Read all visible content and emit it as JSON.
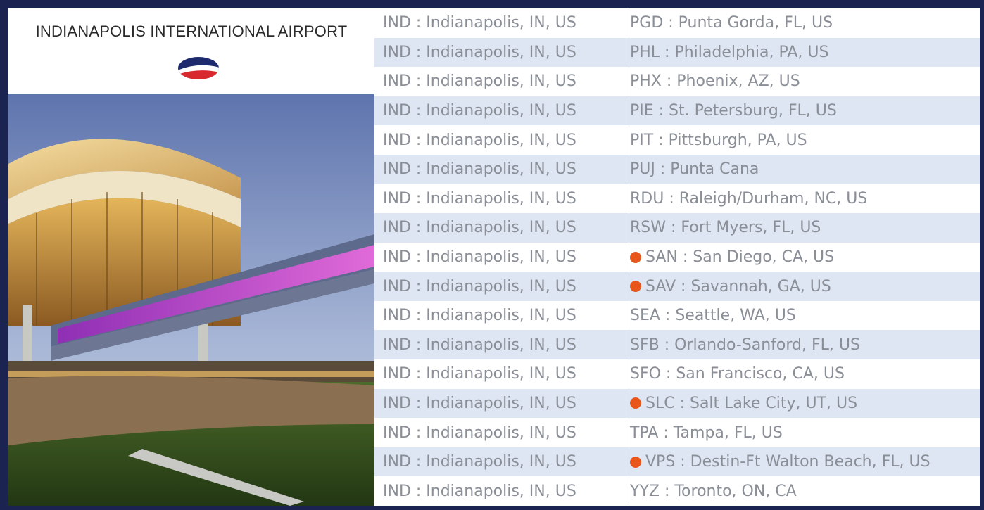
{
  "brand": {
    "title": "INDIANAPOLIS INTERNATIONAL AIRPORT",
    "logo_icon": "airline-logo-icon"
  },
  "colors": {
    "frame": "#1b2350",
    "row_alt": "#dfe6f3",
    "text": "#8a8e96",
    "highlight_dot": "#e8561b"
  },
  "routes": [
    {
      "origin": "IND : Indianapolis, IN, US",
      "dest": "PGD : Punta Gorda, FL, US",
      "highlight": false
    },
    {
      "origin": "IND : Indianapolis, IN, US",
      "dest": "PHL : Philadelphia, PA, US",
      "highlight": false
    },
    {
      "origin": "IND : Indianapolis, IN, US",
      "dest": "PHX : Phoenix, AZ, US",
      "highlight": false
    },
    {
      "origin": "IND : Indianapolis, IN, US",
      "dest": "PIE : St. Petersburg, FL, US",
      "highlight": false
    },
    {
      "origin": "IND : Indianapolis, IN, US",
      "dest": "PIT : Pittsburgh, PA, US",
      "highlight": false
    },
    {
      "origin": "IND : Indianapolis, IN, US",
      "dest": "PUJ : Punta Cana",
      "highlight": false
    },
    {
      "origin": "IND : Indianapolis, IN, US",
      "dest": "RDU : Raleigh/Durham, NC, US",
      "highlight": false
    },
    {
      "origin": "IND : Indianapolis, IN, US",
      "dest": "RSW : Fort Myers, FL, US",
      "highlight": false
    },
    {
      "origin": "IND : Indianapolis, IN, US",
      "dest": "SAN : San Diego, CA, US",
      "highlight": true
    },
    {
      "origin": "IND : Indianapolis, IN, US",
      "dest": "SAV : Savannah, GA, US",
      "highlight": true
    },
    {
      "origin": "IND : Indianapolis, IN, US",
      "dest": "SEA : Seattle, WA, US",
      "highlight": false
    },
    {
      "origin": "IND : Indianapolis, IN, US",
      "dest": "SFB : Orlando-Sanford, FL, US",
      "highlight": false
    },
    {
      "origin": "IND : Indianapolis, IN, US",
      "dest": "SFO : San Francisco, CA, US",
      "highlight": false
    },
    {
      "origin": "IND : Indianapolis, IN, US",
      "dest": "SLC : Salt Lake City, UT, US",
      "highlight": true
    },
    {
      "origin": "IND : Indianapolis, IN, US",
      "dest": "TPA : Tampa, FL, US",
      "highlight": false
    },
    {
      "origin": "IND : Indianapolis, IN, US",
      "dest": "VPS : Destin-Ft Walton Beach, FL, US",
      "highlight": true
    },
    {
      "origin": "IND : Indianapolis, IN, US",
      "dest": "YYZ : Toronto, ON, CA",
      "highlight": false
    }
  ]
}
